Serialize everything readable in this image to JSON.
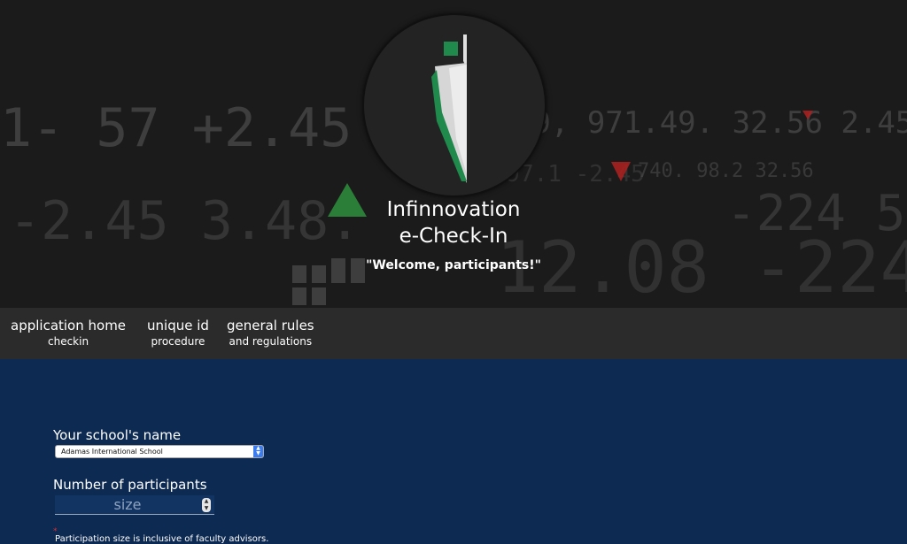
{
  "hero": {
    "title_line1": "Infinnovation",
    "title_line2": "e-Check-In",
    "welcome": "\"Welcome, participants!\"",
    "logo": "infinnovation-pen-logo"
  },
  "nav": {
    "items": [
      {
        "main": "application home",
        "sub": "checkin"
      },
      {
        "main": "unique id",
        "sub": "procedure"
      },
      {
        "main": "general rules",
        "sub": "and regulations"
      }
    ]
  },
  "form": {
    "school_label": "Your school's name",
    "school_value": "Adamas International School",
    "participants_label": "Number of participants",
    "participants_placeholder": "size",
    "note_marker": "*",
    "note": "Participation size is inclusive of faculty advisors."
  },
  "colors": {
    "hero_bg": "#1b1b1b",
    "nav_bg": "#2b2b2b",
    "content_bg": "#0d2a52",
    "logo_green": "#1f8a4c"
  }
}
